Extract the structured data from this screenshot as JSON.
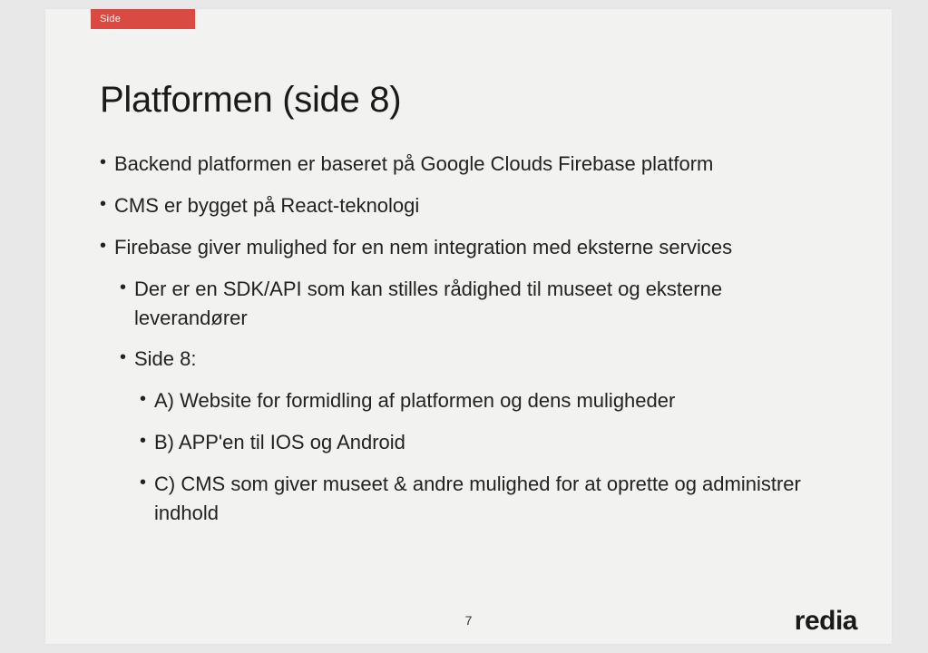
{
  "tab_label": "Side",
  "title": "Platformen (side 8)",
  "bullets": {
    "b0": "Backend platformen er baseret på Google Clouds Firebase platform",
    "b1": "CMS er bygget på React-teknologi",
    "b2": "Firebase giver mulighed for en nem integration med eksterne services",
    "sub": {
      "s0": "Der er en SDK/API som kan stilles rådighed til museet og eksterne leverandører",
      "s1": "Side 8:",
      "sub": {
        "ss0": "A) Website for formidling af platformen og dens muligheder",
        "ss1": "B) APP'en til IOS og Android",
        "ss2": "C) CMS som giver museet & andre mulighed for at oprette og administrer indhold"
      }
    }
  },
  "page_number": "7",
  "logo": "redia"
}
